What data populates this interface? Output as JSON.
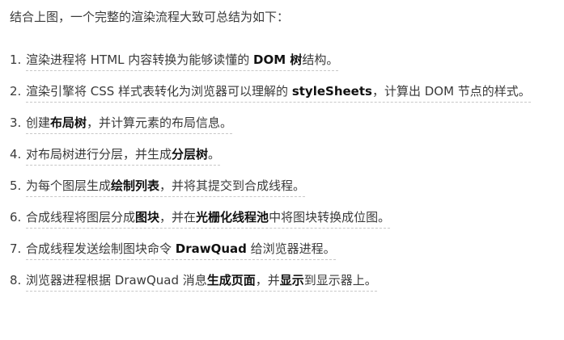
{
  "intro": "结合上图，一个完整的渲染流程大致可总结为如下：",
  "items": [
    {
      "num": "1.",
      "segments": [
        {
          "t": "渲染进程将 HTML 内容转换为能够读懂的 "
        },
        {
          "t": "DOM 树",
          "b": true
        },
        {
          "t": "结构。"
        }
      ]
    },
    {
      "num": "2.",
      "segments": [
        {
          "t": "渲染引擎将 CSS 样式表转化为浏览器可以理解的 "
        },
        {
          "t": "styleSheets",
          "b": true
        },
        {
          "t": "，计算出 DOM 节点的样式。"
        }
      ]
    },
    {
      "num": "3.",
      "segments": [
        {
          "t": "创建"
        },
        {
          "t": "布局树",
          "b": true
        },
        {
          "t": "，并计算元素的布局信息。"
        }
      ]
    },
    {
      "num": "4.",
      "segments": [
        {
          "t": "对布局树进行分层，并生成"
        },
        {
          "t": "分层树",
          "b": true
        },
        {
          "t": "。"
        }
      ]
    },
    {
      "num": "5.",
      "segments": [
        {
          "t": "为每个图层生成"
        },
        {
          "t": "绘制列表",
          "b": true
        },
        {
          "t": "，并将其提交到合成线程。"
        }
      ]
    },
    {
      "num": "6.",
      "segments": [
        {
          "t": "合成线程将图层分成"
        },
        {
          "t": "图块",
          "b": true
        },
        {
          "t": "，并在"
        },
        {
          "t": "光栅化线程池",
          "b": true
        },
        {
          "t": "中将图块转换成位图。"
        }
      ]
    },
    {
      "num": "7.",
      "segments": [
        {
          "t": "合成线程发送绘制图块命令 "
        },
        {
          "t": "DrawQuad",
          "b": true
        },
        {
          "t": " 给浏览器进程。"
        }
      ]
    },
    {
      "num": "8.",
      "segments": [
        {
          "t": "浏览器进程根据 DrawQuad 消息"
        },
        {
          "t": "生成页面",
          "b": true
        },
        {
          "t": "，并"
        },
        {
          "t": "显示",
          "b": true
        },
        {
          "t": "到显示器上。"
        }
      ]
    }
  ]
}
